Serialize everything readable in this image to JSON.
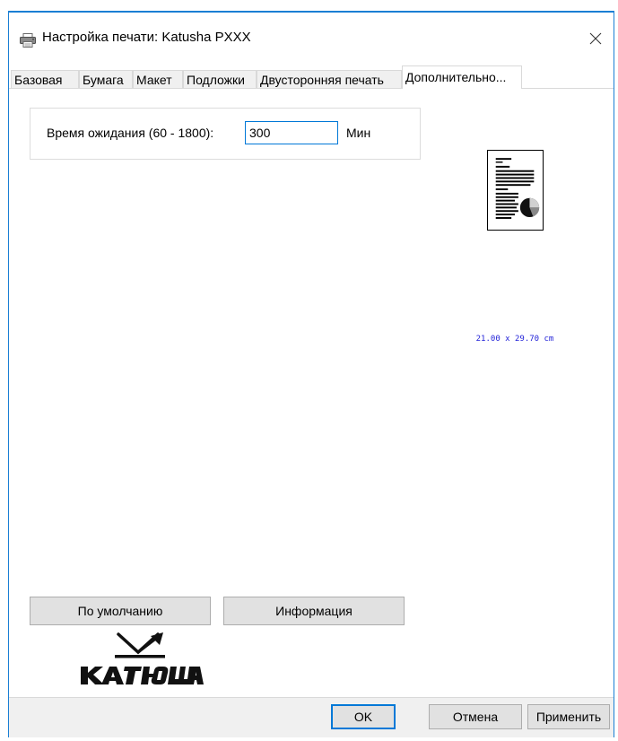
{
  "window": {
    "title": "Настройка печати: Katusha PXXX",
    "icon": "printer-icon",
    "close_icon": "close-icon"
  },
  "tabs": [
    {
      "label": "Базовая",
      "active": false
    },
    {
      "label": "Бумага",
      "active": false
    },
    {
      "label": "Макет",
      "active": false
    },
    {
      "label": "Подложки",
      "active": false
    },
    {
      "label": "Двусторонняя печать",
      "active": false
    },
    {
      "label": "Дополнительно...",
      "active": true
    }
  ],
  "timeout": {
    "label": "Время ожидания (60 - 1800):",
    "value": "300",
    "unit": "Мин"
  },
  "preview": {
    "paper_size": "21.00 x 29.70 cm"
  },
  "buttons": {
    "defaults": "По умолчанию",
    "info": "Информация",
    "ok": "OK",
    "cancel": "Отмена",
    "apply": "Применить"
  },
  "logo": {
    "text": "катюша"
  },
  "colors": {
    "accent": "#0078d7",
    "border": "#1a7fd4",
    "paper_size_text": "#2323d8"
  }
}
